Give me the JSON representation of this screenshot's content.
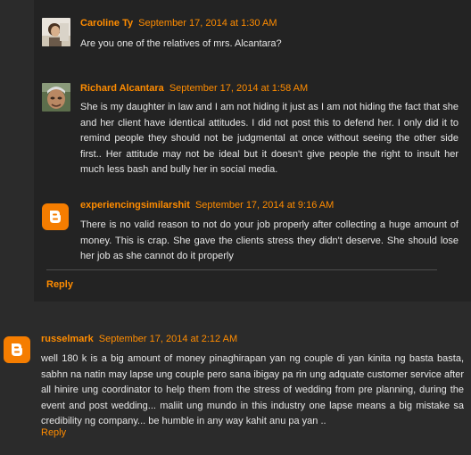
{
  "comments": [
    {
      "author": "Caroline Ty",
      "date": "September 17, 2014 at 1:30 AM",
      "text": "Are you one of the relatives of mrs. Alcantara?"
    },
    {
      "author": "Richard Alcantara",
      "date": "September 17, 2014 at 1:58 AM",
      "text": "She is my daughter in law and I am not hiding it just as I am not hiding the fact that she and her client have identical attitudes. I did not post this to defend her. I only did it to remind people they should not be judgmental at once without seeing the other side first.. Her attitude may not be ideal but it doesn't give people the right to insult her much less bash and bully her in social media."
    },
    {
      "author": "experiencingsimilarshit",
      "date": "September 17, 2014 at 9:16 AM",
      "text": "There is no valid reason to not do your job properly after collecting a huge amount of money. This is crap. She gave the clients stress they didn't deserve. She should lose her job as she cannot do it properly"
    },
    {
      "author": "russelmark",
      "date": "September 17, 2014 at 2:12 AM",
      "text": "well 180 k is a big amount of money pinaghirapan yan ng couple di yan kinita ng basta basta, sabhn na natin may lapse ung couple pero sana ibigay pa rin ung adquate customer service after all hinire ung coordinator to help them from the stress of wedding from pre planning, during the event and post wedding... maliit ung mundo in this industry one lapse means a big mistake sa credibility ng company... be humble in any way kahit anu pa yan .."
    }
  ],
  "reply_label": "Reply",
  "colors": {
    "accent": "#ff8c00",
    "blogger": "#f57d00",
    "panel": "#232323",
    "page": "#2b2b2b"
  },
  "icons": [
    "avatar-photo",
    "blogger-icon"
  ]
}
